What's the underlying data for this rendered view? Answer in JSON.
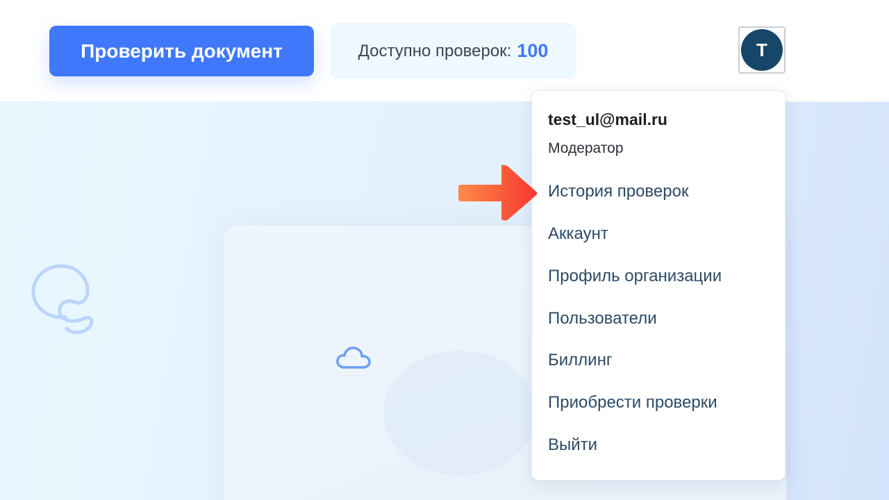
{
  "header": {
    "check_button_label": "Проверить документ",
    "available_checks_label": "Доступно проверок:",
    "available_checks_count": "100",
    "avatar_initial": "T"
  },
  "account_menu": {
    "email": "test_ul@mail.ru",
    "role": "Модератор",
    "items": [
      {
        "label": "История проверок"
      },
      {
        "label": "Аккаунт"
      },
      {
        "label": "Профиль организации"
      },
      {
        "label": "Пользователи"
      },
      {
        "label": "Биллинг"
      },
      {
        "label": "Приобрести проверки"
      },
      {
        "label": "Выйти"
      }
    ]
  },
  "colors": {
    "primary": "#3f78fb",
    "avatar": "#164768",
    "menu_text": "#2c4a66",
    "annotation_arrow": "#f7463a"
  },
  "icons": [
    "swirl-logo-icon",
    "cloud-icon",
    "annotation-arrow-icon"
  ]
}
